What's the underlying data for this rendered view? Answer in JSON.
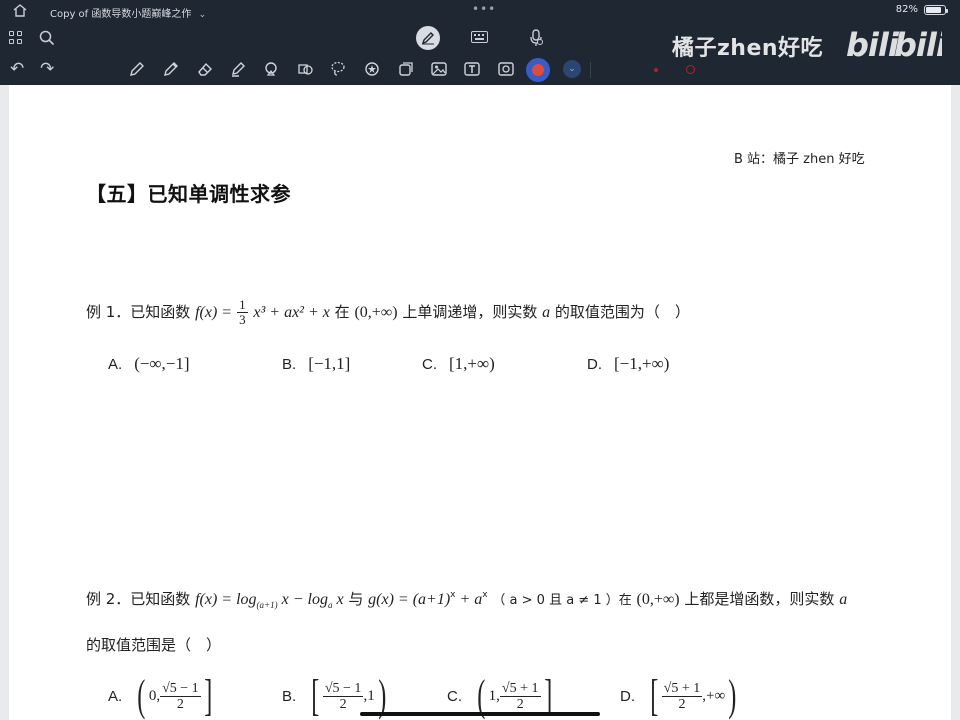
{
  "status_bar": {
    "doc_title": "Copy of 函数导数小题巅峰之作",
    "chevron": "⌄",
    "dots": "•••",
    "battery_text": "82%",
    "battery_level": 0.82
  },
  "toolbar": {
    "undo_label": "↶",
    "redo_label": "↷",
    "active_color": "#e04a3f"
  },
  "watermark": {
    "text": "橘子zhen好吃",
    "logo": "bilibili"
  },
  "page": {
    "credit": "B 站：橘子 zhen 好吃",
    "section_title": "【五】已知单调性求参",
    "q1": {
      "prefix": "例 1．已知函数",
      "func": "f(x) = ",
      "frac_num": "1",
      "frac_den": "3",
      "expr_rest": "x³ + ax² + x",
      "mid": "在",
      "interval": "(0,+∞)",
      "suffix": "上单调递增，则实数",
      "var": "a",
      "tail": "的取值范围为（　）",
      "options": [
        {
          "label": "A.",
          "value": "(−∞,−1]"
        },
        {
          "label": "B.",
          "value": "[−1,1]"
        },
        {
          "label": "C.",
          "value": "[1,+∞)"
        },
        {
          "label": "D.",
          "value": "[−1,+∞)"
        }
      ]
    },
    "q2": {
      "prefix": "例 2．已知函数",
      "expr": "f(x) = log",
      "sub1": "(a+1)",
      "expr2": " x − log",
      "sub2": "a",
      "expr3": " x",
      "with": "与",
      "gexpr": "g(x) = (a+1)",
      "gsup": "x",
      "gexpr2": " + a",
      "gsup2": "x",
      "cond": "（ a > 0 且 a ≠ 1 ）在",
      "interval": "(0,+∞)",
      "suffix": "上都是增函数，则实数",
      "var": "a",
      "line2": "的取值范围是（　）",
      "options": [
        {
          "label": "A.",
          "left": "(",
          "pre": "0,",
          "num": "√5 − 1",
          "den": "2",
          "post": "",
          "right": "]"
        },
        {
          "label": "B.",
          "left": "[",
          "pre": "",
          "num": "√5 − 1",
          "den": "2",
          "post": ",1",
          "right": ")"
        },
        {
          "label": "C.",
          "left": "(",
          "pre": "1,",
          "num": "√5 + 1",
          "den": "2",
          "post": "",
          "right": "]"
        },
        {
          "label": "D.",
          "left": "[",
          "pre": "",
          "num": "√5 + 1",
          "den": "2",
          "post": ",+∞",
          "right": ")"
        }
      ]
    }
  }
}
